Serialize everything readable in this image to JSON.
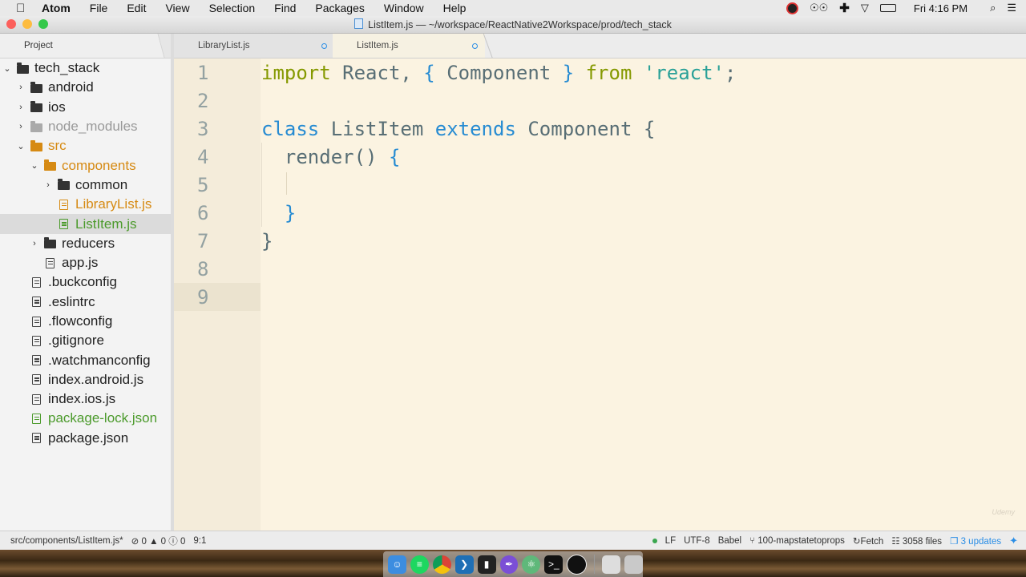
{
  "menubar": {
    "app_name": "Atom",
    "items": [
      "File",
      "Edit",
      "View",
      "Selection",
      "Find",
      "Packages",
      "Window",
      "Help"
    ],
    "clock": "Fri 4:16 PM"
  },
  "window": {
    "title": "ListItem.js — ~/workspace/ReactNative2Workspace/prod/tech_stack",
    "lights": [
      "#fc605c",
      "#fdbc40",
      "#34c84a"
    ]
  },
  "tree": {
    "header": "Project",
    "rows": [
      {
        "label": "tech_stack",
        "type": "folder",
        "chevron": "⌄",
        "indent": 0,
        "color": "default"
      },
      {
        "label": "android",
        "type": "folder",
        "chevron": "›",
        "indent": 1,
        "color": "default"
      },
      {
        "label": "ios",
        "type": "folder",
        "chevron": "›",
        "indent": 1,
        "color": "default"
      },
      {
        "label": "node_modules",
        "type": "folder",
        "chevron": "›",
        "indent": 1,
        "color": "muted"
      },
      {
        "label": "src",
        "type": "folder",
        "chevron": "⌄",
        "indent": 1,
        "color": "orange"
      },
      {
        "label": "components",
        "type": "folder",
        "chevron": "⌄",
        "indent": 2,
        "color": "orange"
      },
      {
        "label": "common",
        "type": "folder",
        "chevron": "›",
        "indent": 3,
        "color": "default"
      },
      {
        "label": "LibraryList.js",
        "type": "file",
        "chevron": "",
        "indent": 3,
        "color": "orange"
      },
      {
        "label": "ListItem.js",
        "type": "file",
        "chevron": "",
        "indent": 3,
        "color": "green",
        "selected": true
      },
      {
        "label": "reducers",
        "type": "folder",
        "chevron": "›",
        "indent": 2,
        "color": "default"
      },
      {
        "label": "app.js",
        "type": "file",
        "chevron": "",
        "indent": 2,
        "color": "default"
      },
      {
        "label": ".buckconfig",
        "type": "file",
        "chevron": "",
        "indent": 1,
        "color": "default"
      },
      {
        "label": ".eslintrc",
        "type": "file",
        "chevron": "",
        "indent": 1,
        "color": "default"
      },
      {
        "label": ".flowconfig",
        "type": "file",
        "chevron": "",
        "indent": 1,
        "color": "default"
      },
      {
        "label": ".gitignore",
        "type": "file",
        "chevron": "",
        "indent": 1,
        "color": "default"
      },
      {
        "label": ".watchmanconfig",
        "type": "file",
        "chevron": "",
        "indent": 1,
        "color": "default"
      },
      {
        "label": "index.android.js",
        "type": "file",
        "chevron": "",
        "indent": 1,
        "color": "default"
      },
      {
        "label": "index.ios.js",
        "type": "file",
        "chevron": "",
        "indent": 1,
        "color": "default"
      },
      {
        "label": "package-lock.json",
        "type": "file",
        "chevron": "",
        "indent": 1,
        "color": "green"
      },
      {
        "label": "package.json",
        "type": "file",
        "chevron": "",
        "indent": 1,
        "color": "default"
      }
    ]
  },
  "tabs": [
    {
      "label": "LibraryList.js",
      "active": false
    },
    {
      "label": "ListItem.js",
      "active": true
    }
  ],
  "editor": {
    "line_numbers": [
      "1",
      "2",
      "3",
      "4",
      "5",
      "6",
      "7",
      "8",
      "9"
    ],
    "lines": [
      [
        {
          "t": "import",
          "c": "kw-import"
        },
        {
          "t": " React, ",
          "c": "ident"
        },
        {
          "t": "{",
          "c": "brace"
        },
        {
          "t": " Component ",
          "c": "ident"
        },
        {
          "t": "}",
          "c": "brace"
        },
        {
          "t": " ",
          "c": "ident"
        },
        {
          "t": "from",
          "c": "kw-from"
        },
        {
          "t": " ",
          "c": "ident"
        },
        {
          "t": "'react'",
          "c": "str"
        },
        {
          "t": ";",
          "c": "ident"
        }
      ],
      [],
      [
        {
          "t": "class",
          "c": "kw-class"
        },
        {
          "t": " ListItem ",
          "c": "ident"
        },
        {
          "t": "extends",
          "c": "kw-class"
        },
        {
          "t": " Component ",
          "c": "ident"
        },
        {
          "t": "{",
          "c": "ident"
        }
      ],
      [
        {
          "t": "  render() ",
          "c": "ident"
        },
        {
          "t": "{",
          "c": "brace"
        }
      ],
      [],
      [
        {
          "t": "  ",
          "c": "ident"
        },
        {
          "t": "}",
          "c": "brace"
        }
      ],
      [
        {
          "t": "}",
          "c": "ident"
        }
      ],
      [],
      []
    ],
    "watermark": "Udemy"
  },
  "status": {
    "path": "src/components/ListItem.js*",
    "errors": "0",
    "warnings": "0",
    "infos": "0",
    "cursor": "9:1",
    "line_ending": "LF",
    "encoding": "UTF-8",
    "grammar": "Babel",
    "branch": "100-mapstatetoprops",
    "fetch": "Fetch",
    "files": "3058 files",
    "updates": "3 updates"
  }
}
